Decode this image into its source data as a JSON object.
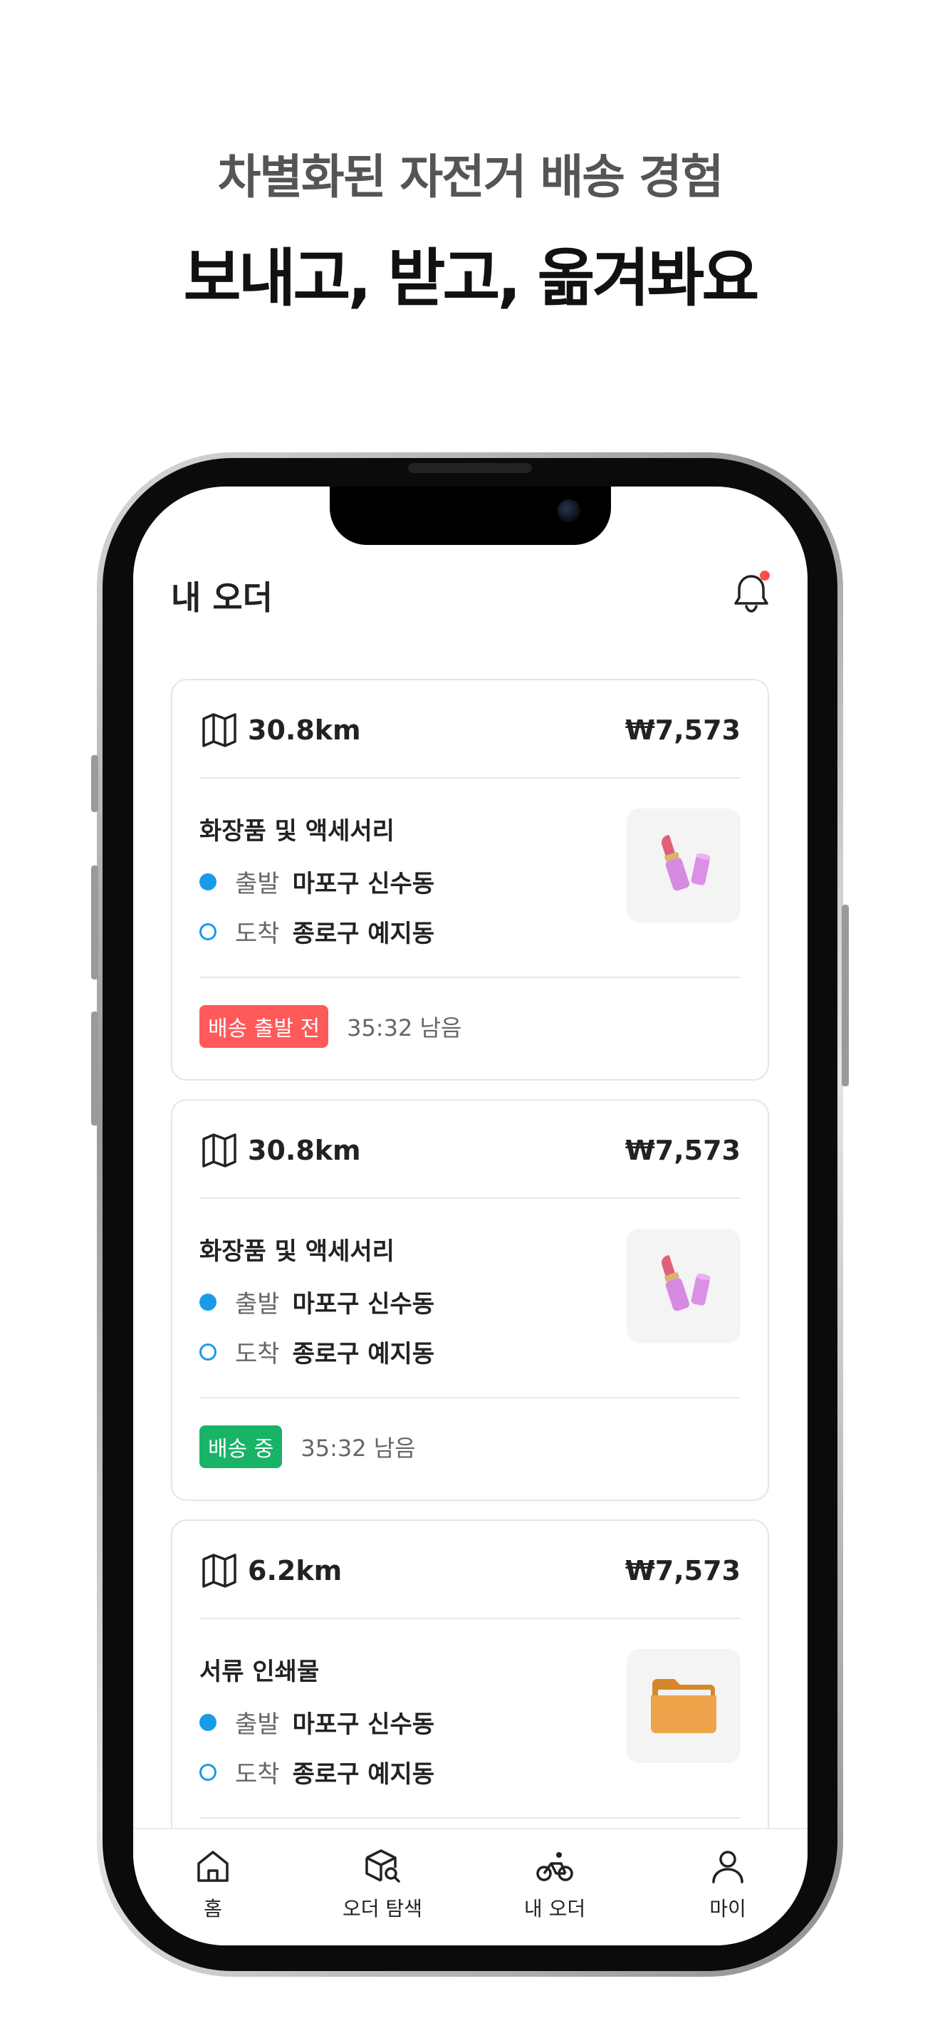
{
  "marketing": {
    "subtitle": "차별화된 자전거 배송 경험",
    "headline": "보내고, 받고, 옮겨봐요"
  },
  "header": {
    "title": "내 오더"
  },
  "orders": [
    {
      "distance": "30.8km",
      "price": "₩7,573",
      "category": "화장품 및 액세서리",
      "depart_label": "출발",
      "depart_place": "마포구 신수동",
      "arrive_label": "도착",
      "arrive_place": "종로구 예지동",
      "status": "배송 출발 전",
      "status_color": "#ff5a5a",
      "remaining": "35:32 남음",
      "thumb_icon": "lipstick-icon"
    },
    {
      "distance": "30.8km",
      "price": "₩7,573",
      "category": "화장품 및 액세서리",
      "depart_label": "출발",
      "depart_place": "마포구 신수동",
      "arrive_label": "도착",
      "arrive_place": "종로구 예지동",
      "status": "배송 중",
      "status_color": "#19b368",
      "remaining": "35:32 남음",
      "thumb_icon": "lipstick-icon"
    },
    {
      "distance": "6.2km",
      "price": "₩7,573",
      "category": "서류 인쇄물",
      "depart_label": "출발",
      "depart_place": "마포구 신수동",
      "arrive_label": "도착",
      "arrive_place": "종로구 예지동",
      "thumb_icon": "folder-icon"
    }
  ],
  "tabbar": {
    "items": [
      {
        "label": "홈",
        "icon": "home-icon"
      },
      {
        "label": "오더 탐색",
        "icon": "package-search-icon"
      },
      {
        "label": "내 오더",
        "icon": "bicycle-icon"
      },
      {
        "label": "마이",
        "icon": "user-icon"
      }
    ]
  },
  "colors": {
    "accent_blue": "#1a9be8",
    "status_red": "#ff5a5a",
    "status_green": "#19b368",
    "notification_dot": "#ff4d4f"
  }
}
